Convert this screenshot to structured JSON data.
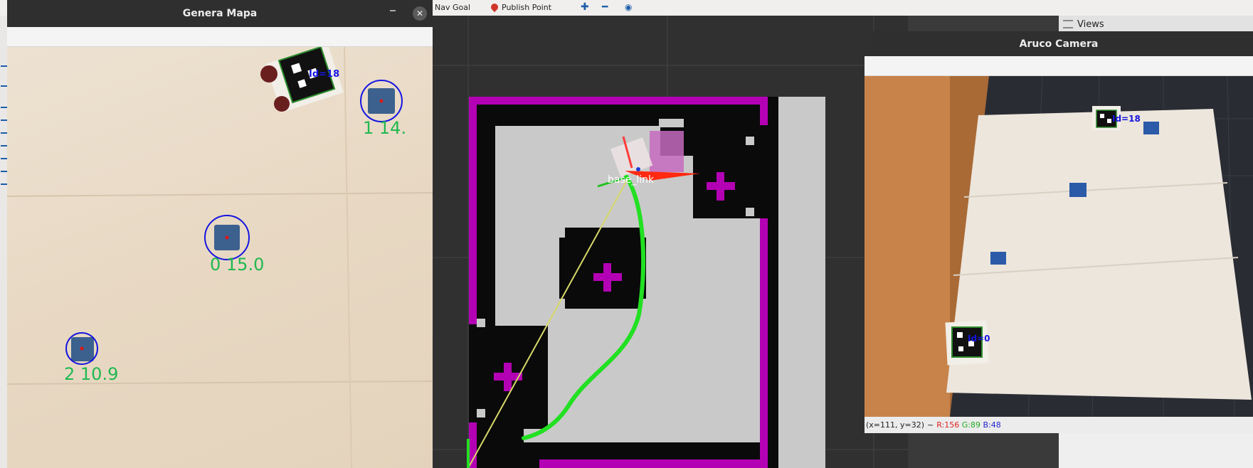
{
  "toolbar": {
    "nav_goal": "Nav Goal",
    "publish_point": "Publish Point"
  },
  "genera_mapa": {
    "title": "Genera Mapa",
    "markers": [
      {
        "label": "0 15.0"
      },
      {
        "label": "1 14."
      },
      {
        "label": "2 10.9"
      }
    ],
    "robot_id": "Id=18"
  },
  "rviz": {
    "robot_frame_label": "base_link"
  },
  "views_panel": {
    "title": "Views"
  },
  "aruco_camera": {
    "title": "Aruco Camera",
    "robot_id": "Id=18",
    "origin_id": "Id=0",
    "status": {
      "coords": "(x=111, y=32)",
      "sep": "~",
      "r": "R:156",
      "g": "G:89",
      "b": "B:48"
    }
  },
  "colors": {
    "window_title_bg": "#2f2f2f",
    "map_wall": "#b400b4",
    "path_green": "#22e022",
    "marker_circle": "#1515e0",
    "marker_label": "#21b850"
  }
}
